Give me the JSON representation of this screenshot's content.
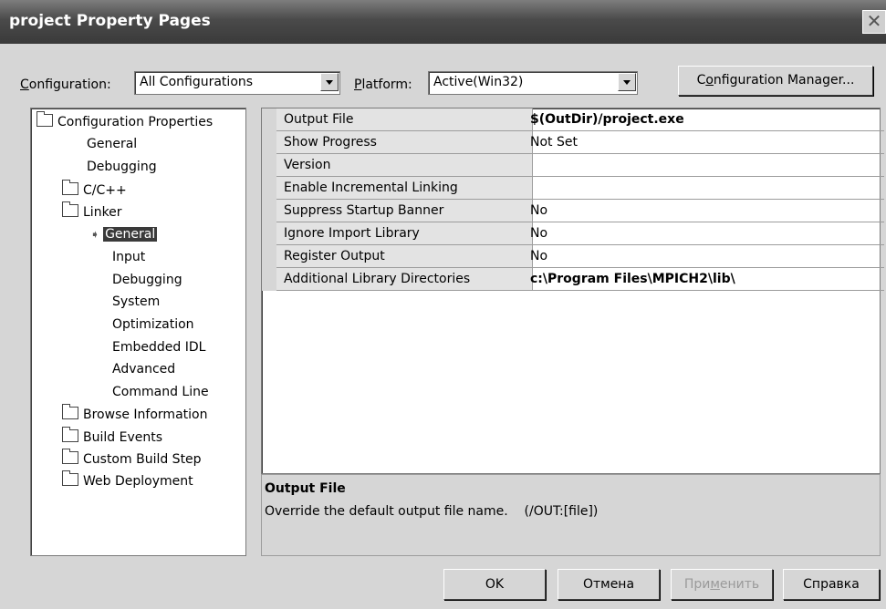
{
  "window": {
    "title": "project Property Pages",
    "close_label": "✕"
  },
  "toolbar": {
    "configuration_label": "onfiguration:",
    "configuration_accel": "C",
    "configuration_value": "All Configurations",
    "platform_label": "latform:",
    "platform_accel": "P",
    "platform_value": "Active(Win32)",
    "config_manager_pre": "C",
    "config_manager_accel": "o",
    "config_manager_post": "nfiguration Manager..."
  },
  "tree": {
    "items": [
      {
        "label": "Configuration Properties",
        "icon": "folder-open-icon"
      },
      {
        "label": "General"
      },
      {
        "label": "Debugging"
      },
      {
        "label": "C/C++",
        "icon": "folder-icon"
      },
      {
        "label": "Linker",
        "icon": "folder-open-icon"
      },
      {
        "label": "General",
        "selected": true
      },
      {
        "label": "Input"
      },
      {
        "label": "Debugging"
      },
      {
        "label": "System"
      },
      {
        "label": "Optimization"
      },
      {
        "label": "Embedded IDL"
      },
      {
        "label": "Advanced"
      },
      {
        "label": "Command Line"
      },
      {
        "label": "Browse Information",
        "icon": "folder-icon"
      },
      {
        "label": "Build Events",
        "icon": "folder-icon"
      },
      {
        "label": "Custom Build Step",
        "icon": "folder-icon"
      },
      {
        "label": "Web Deployment",
        "icon": "folder-icon"
      }
    ]
  },
  "properties": [
    {
      "name": "Output File",
      "value": "$(OutDir)/project.exe",
      "bold": true
    },
    {
      "name": "Show Progress",
      "value": "Not Set",
      "bold": false
    },
    {
      "name": "Version",
      "value": "",
      "bold": false
    },
    {
      "name": "Enable Incremental Linking",
      "value": "",
      "bold": false
    },
    {
      "name": "Suppress Startup Banner",
      "value": "No",
      "bold": false
    },
    {
      "name": "Ignore Import Library",
      "value": "No",
      "bold": false
    },
    {
      "name": "Register Output",
      "value": "No",
      "bold": false
    },
    {
      "name": "Additional Library Directories",
      "value": "c:\\Program Files\\MPICH2\\lib\\",
      "bold": true
    }
  ],
  "description": {
    "title": "Output File",
    "text": "Override the default output file name.    (/OUT:[file])"
  },
  "buttons": {
    "ok": "OK",
    "cancel": "Отмена",
    "apply_pre": "При",
    "apply_accel": "м",
    "apply_post": "енить",
    "help": "Справка"
  },
  "colors": {
    "selection": "#3a3a3a",
    "title_bar": "#4a4a4a",
    "face": "#d6d6d6"
  }
}
